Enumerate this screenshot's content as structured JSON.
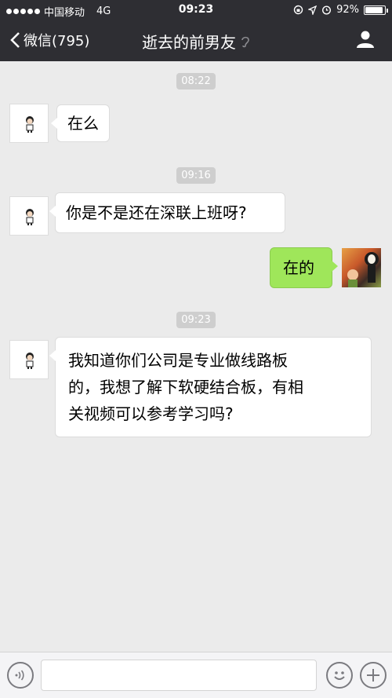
{
  "statusbar": {
    "carrier": "中国移动",
    "network": "4G",
    "time": "09:23",
    "battery": "92%",
    "battery_level": 0.92
  },
  "navbar": {
    "back_label": "微信(795)",
    "title": "逝去的前男友"
  },
  "messages": [
    {
      "timestamp": "08:22",
      "side": "left",
      "text": "在么"
    },
    {
      "timestamp": "09:16",
      "side": "left",
      "text": "你是不是还在深联上班呀?"
    },
    {
      "side": "right",
      "text": "在的"
    },
    {
      "timestamp": "09:23",
      "side": "left",
      "lines": [
        "我知道你们公司是专业做线路板",
        "的，我想了解下软硬结合板，有相",
        "关视频可以参考学习吗?"
      ]
    }
  ],
  "icons": {
    "back": "chevron-left-icon",
    "ear": "ear-icon",
    "profile": "person-icon",
    "voice": "voice-icon",
    "emoji": "emoji-icon",
    "plus": "plus-icon"
  }
}
